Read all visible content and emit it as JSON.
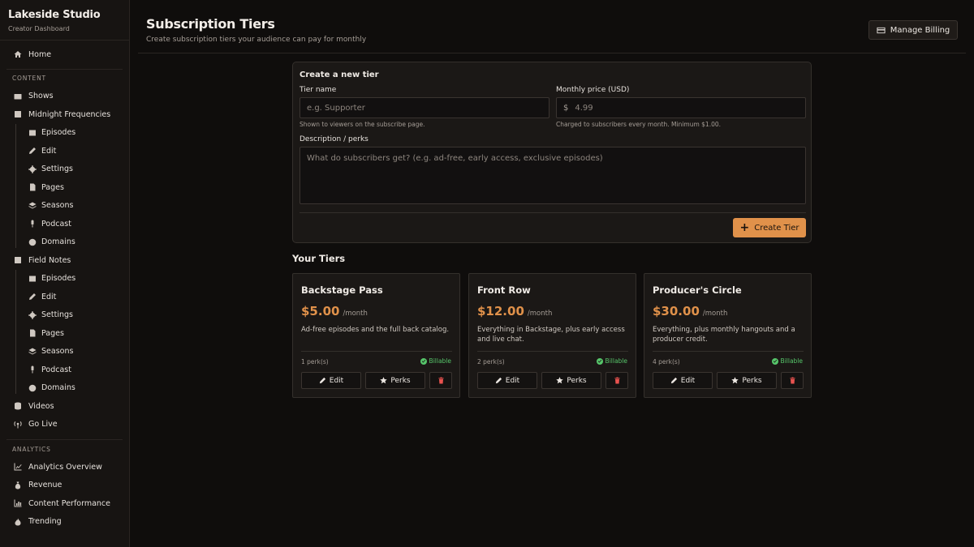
{
  "brand": {
    "name": "Lakeside Studio",
    "subtitle": "Creator Dashboard"
  },
  "sidebar": {
    "home": "Home",
    "content_label": "CONTENT",
    "shows": "Shows",
    "show1": {
      "name": "Midnight Frequencies",
      "items": [
        "Episodes",
        "Edit",
        "Settings",
        "Pages",
        "Seasons",
        "Podcast",
        "Domains"
      ]
    },
    "show2": {
      "name": "Field Notes",
      "items": [
        "Episodes",
        "Edit",
        "Settings",
        "Pages",
        "Seasons",
        "Podcast",
        "Domains"
      ]
    },
    "videos": "Videos",
    "go_live": "Go Live",
    "analytics_label": "ANALYTICS",
    "analytics_overview": "Analytics Overview",
    "revenue": "Revenue",
    "content_performance": "Content Performance",
    "trending": "Trending"
  },
  "header": {
    "title": "Subscription Tiers",
    "subtitle": "Create subscription tiers your audience can pay for monthly",
    "billing_button": "Manage Billing"
  },
  "form": {
    "title": "Create a new tier",
    "tier_name_label": "Tier name",
    "tier_name_placeholder": "e.g. Supporter",
    "tier_name_hint": "Shown to viewers on the subscribe page.",
    "price_label": "Monthly price (USD)",
    "currency_symbol": "$",
    "price_placeholder": "4.99",
    "price_hint": "Charged to subscribers every month. Minimum $1.00.",
    "description_label": "Description / perks",
    "description_placeholder": "What do subscribers get? (e.g. ad-free, early access, exclusive episodes)",
    "create_button": "Create Tier"
  },
  "tiers_heading": "Your Tiers",
  "tiers": [
    {
      "name": "Backstage Pass",
      "price": "$5.00",
      "period": "/month",
      "description": "Ad-free episodes and the full back catalog.",
      "perks": "1 perk(s)",
      "status": "Billable",
      "edit": "Edit",
      "perks_button": "Perks"
    },
    {
      "name": "Front Row",
      "price": "$12.00",
      "period": "/month",
      "description": "Everything in Backstage, plus early access and live chat.",
      "perks": "2 perk(s)",
      "status": "Billable",
      "edit": "Edit",
      "perks_button": "Perks"
    },
    {
      "name": "Producer's Circle",
      "price": "$30.00",
      "period": "/month",
      "description": "Everything, plus monthly hangouts and a producer credit.",
      "perks": "4 perk(s)",
      "status": "Billable",
      "edit": "Edit",
      "perks_button": "Perks"
    }
  ],
  "colors": {
    "accent": "#e0914a",
    "success": "#56c56a",
    "danger": "#e8524f",
    "background": "#0f0d0c",
    "sidebar": "#171412"
  }
}
